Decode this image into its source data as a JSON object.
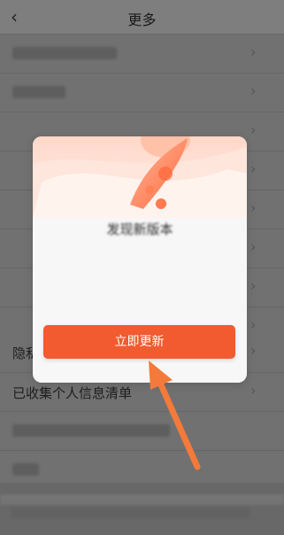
{
  "header": {
    "back_icon": "chevron-left-icon",
    "back_glyph": "‹",
    "title": "更多"
  },
  "list": {
    "items": [
      {
        "label": "隐私政策",
        "label_visible_part": "隐私"
      },
      {
        "label": "已收集个人信息清单"
      }
    ],
    "chevron_glyph": "›"
  },
  "dialog": {
    "title": "发现新版本",
    "subtitle": "",
    "body": "",
    "update_button": "立即更新"
  },
  "colors": {
    "accent": "#f25a30",
    "pointer_arrow": "#f47a3b"
  }
}
